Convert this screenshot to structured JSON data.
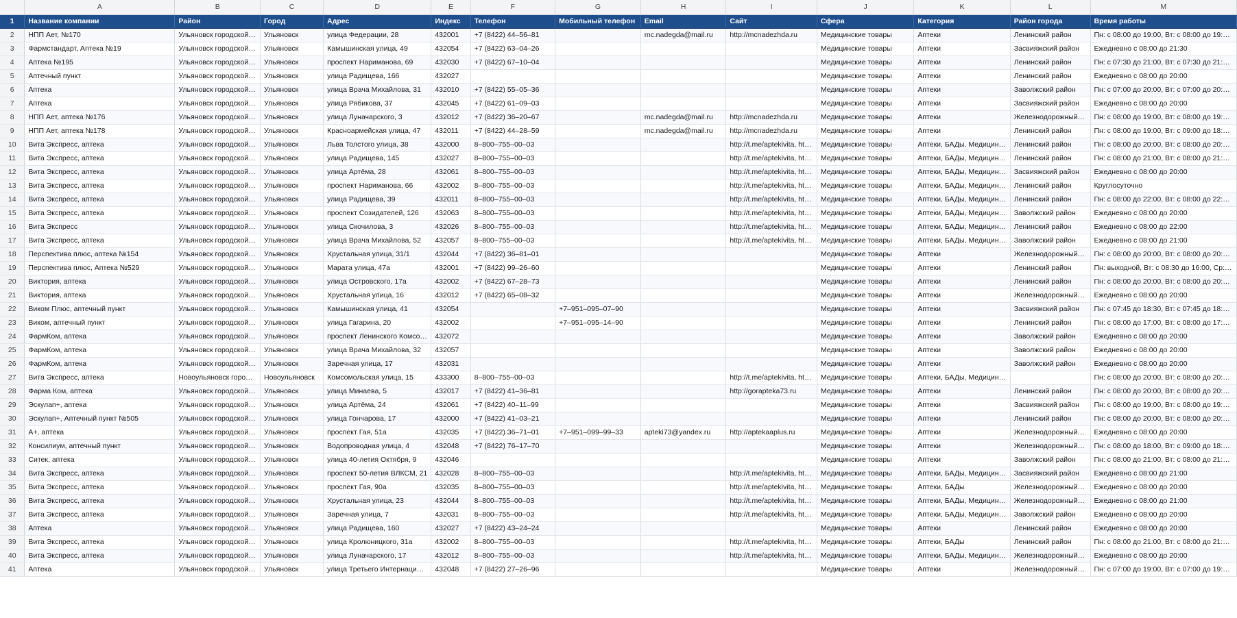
{
  "columns": [
    "A",
    "B",
    "C",
    "D",
    "E",
    "F",
    "G",
    "H",
    "I",
    "J",
    "K",
    "L",
    "M"
  ],
  "header": {
    "row": "1",
    "cells": [
      "Название компании",
      "Район",
      "Город",
      "Адрес",
      "Индекс",
      "Телефон",
      "Мобильный телефон",
      "Email",
      "Сайт",
      "Сфера",
      "Категория",
      "Район города",
      "Время работы"
    ]
  },
  "rows": [
    {
      "n": "2",
      "c": [
        "НПП Ает, №170",
        "Ульяновск городской …",
        "Ульяновск",
        "улица Федерации, 28",
        "432001",
        "+7 (8422) 44–56–81",
        "",
        "mc.nadegda@mail.ru",
        "http://mcnadezhda.ru",
        "Медицинские товары",
        "Аптеки",
        "Ленинский район",
        "Пн: с 08:00 до 19:00, Вт: с 08:00 до 19:00, С…"
      ]
    },
    {
      "n": "3",
      "c": [
        "Фармстандарт, Аптека №19",
        "Ульяновск городской …",
        "Ульяновск",
        "Камышинская улица, 49",
        "432054",
        "+7 (8422) 63–04–26",
        "",
        "",
        "",
        "Медицинские товары",
        "Аптеки",
        "Засвияжский район",
        "Ежедневно с 08:00 до 21:30"
      ]
    },
    {
      "n": "4",
      "c": [
        "Аптека №195",
        "Ульяновск городской …",
        "Ульяновск",
        "проспект Нариманова, 69",
        "432030",
        "+7 (8422) 67–10–04",
        "",
        "",
        "",
        "Медицинские товары",
        "Аптеки",
        "Ленинский район",
        "Пн: с 07:30 до 21:00, Вт: с 07:30 до 21:00, С…"
      ]
    },
    {
      "n": "5",
      "c": [
        "Аптечный пункт",
        "Ульяновск городской …",
        "Ульяновск",
        "улица Радищева, 166",
        "432027",
        "",
        "",
        "",
        "",
        "Медицинские товары",
        "Аптеки",
        "Ленинский район",
        "Ежедневно с 08:00 до 20:00"
      ]
    },
    {
      "n": "6",
      "c": [
        "Аптека",
        "Ульяновск городской …",
        "Ульяновск",
        "улица Врача Михайлова, 31",
        "432010",
        "+7 (8422) 55–05–36",
        "",
        "",
        "",
        "Медицинские товары",
        "Аптеки",
        "Заволжский район",
        "Пн: с 07:00 до 20:00, Вт: с 07:00 до 20:00, С…"
      ]
    },
    {
      "n": "7",
      "c": [
        "Аптека",
        "Ульяновск городской …",
        "Ульяновск",
        "улица Рябикова, 37",
        "432045",
        "+7 (8422) 61–09–03",
        "",
        "",
        "",
        "Медицинские товары",
        "Аптеки",
        "Засвияжский район",
        "Ежедневно с 08:00 до 20:00"
      ]
    },
    {
      "n": "8",
      "c": [
        "НПП Ает, аптека №176",
        "Ульяновск городской …",
        "Ульяновск",
        "улица Луначарского, 3",
        "432012",
        "+7 (8422) 36–20–67",
        "",
        "mc.nadegda@mail.ru",
        "http://mcnadezhda.ru",
        "Медицинские товары",
        "Аптеки",
        "Железнодорожный р…",
        "Пн: с 08:00 до 19:00, Вт: с 08:00 до 19:00, С…"
      ]
    },
    {
      "n": "9",
      "c": [
        "НПП Ает, аптека №178",
        "Ульяновск городской …",
        "Ульяновск",
        "Красноармейская улица, 47",
        "432011",
        "+7 (8422) 44–28–59",
        "",
        "mc.nadegda@mail.ru",
        "http://mcnadezhda.ru",
        "Медицинские товары",
        "Аптеки",
        "Ленинский район",
        "Пн: с 08:00 до 19:00, Вт: с 09:00 до 18:00, С…"
      ]
    },
    {
      "n": "10",
      "c": [
        "Вита Экспресс, аптека",
        "Ульяновск городской …",
        "Ульяновск",
        "Льва Толстого улица, 38",
        "432000",
        "8–800–755–00–03",
        "",
        "",
        "http://t.me/aptekivita, htt…",
        "Медицинские товары",
        "Аптеки, БАДы, Медицинск…",
        "Ленинский район",
        "Пн: с 08:00 до 20:00, Вт: с 08:00 до 20:00, С…"
      ]
    },
    {
      "n": "11",
      "c": [
        "Вита Экспресс, аптека",
        "Ульяновск городской …",
        "Ульяновск",
        "улица Радищева, 145",
        "432027",
        "8–800–755–00–03",
        "",
        "",
        "http://t.me/aptekivita, htt…",
        "Медицинские товары",
        "Аптеки, БАДы, Медицинск…",
        "Ленинский район",
        "Пн: с 08:00 до 21:00, Вт: с 08:00 до 21:00, С…"
      ]
    },
    {
      "n": "12",
      "c": [
        "Вита Экспресс, аптека",
        "Ульяновск городской …",
        "Ульяновск",
        "улица Артёма, 28",
        "432061",
        "8–800–755–00–03",
        "",
        "",
        "http://t.me/aptekivita, htt…",
        "Медицинские товары",
        "Аптеки, БАДы, Медицинск…",
        "Засвияжский район",
        "Ежедневно с 08:00 до 20:00"
      ]
    },
    {
      "n": "13",
      "c": [
        "Вита Экспресс, аптека",
        "Ульяновск городской …",
        "Ульяновск",
        "проспект Нариманова, 66",
        "432002",
        "8–800–755–00–03",
        "",
        "",
        "http://t.me/aptekivita, htt…",
        "Медицинские товары",
        "Аптеки, БАДы, Медицинск…",
        "Ленинский район",
        "Круглосуточно"
      ]
    },
    {
      "n": "14",
      "c": [
        "Вита Экспресс, аптека",
        "Ульяновск городской …",
        "Ульяновск",
        "улица Радищева, 39",
        "432011",
        "8–800–755–00–03",
        "",
        "",
        "http://t.me/aptekivita, htt…",
        "Медицинские товары",
        "Аптеки, БАДы, Медицинск…",
        "Ленинский район",
        "Пн: с 08:00 до 22:00, Вт: с 08:00 до 22:00, С…"
      ]
    },
    {
      "n": "15",
      "c": [
        "Вита Экспресс, аптека",
        "Ульяновск городской …",
        "Ульяновск",
        "проспект Созидателей, 126",
        "432063",
        "8–800–755–00–03",
        "",
        "",
        "http://t.me/aptekivita, htt…",
        "Медицинские товары",
        "Аптеки, БАДы, Медицинск…",
        "Заволжский район",
        "Ежедневно с 08:00 до 20:00"
      ]
    },
    {
      "n": "16",
      "c": [
        "Вита Экспресс",
        "Ульяновск городской …",
        "Ульяновск",
        "улица Скочилова, 3",
        "432026",
        "8–800–755–00–03",
        "",
        "",
        "http://t.me/aptekivita, htt…",
        "Медицинские товары",
        "Аптеки, БАДы, Медицинск…",
        "Ленинский район",
        "Ежедневно с 08:00 до 22:00"
      ]
    },
    {
      "n": "17",
      "c": [
        "Вита Экспресс, аптека",
        "Ульяновск городской …",
        "Ульяновск",
        "улица Врача Михайлова, 52",
        "432057",
        "8–800–755–00–03",
        "",
        "",
        "http://t.me/aptekivita, htt…",
        "Медицинские товары",
        "Аптеки, БАДы, Медицинск…",
        "Заволжский район",
        "Ежедневно с 08:00 до 21:00"
      ]
    },
    {
      "n": "18",
      "c": [
        "Перспектива плюс, аптека №154",
        "Ульяновск городской …",
        "Ульяновск",
        "Хрустальная улица, 31/1",
        "432044",
        "+7 (8422) 36–81–01",
        "",
        "",
        "",
        "Медицинские товары",
        "Аптеки",
        "Железнодорожный р…",
        "Пн: с 08:00 до 20:00, Вт: с 08:00 до 20:00, С…"
      ]
    },
    {
      "n": "19",
      "c": [
        "Перспектива плюс, Аптека №529",
        "Ульяновск городской …",
        "Ульяновск",
        "Марата улица, 47а",
        "432001",
        "+7 (8422) 99–26–60",
        "",
        "",
        "",
        "Медицинские товары",
        "Аптеки",
        "Ленинский район",
        "Пн: выходной, Вт: с 08:30 до 16:00, Ср: с 0…"
      ]
    },
    {
      "n": "20",
      "c": [
        "Виктория, аптека",
        "Ульяновск городской …",
        "Ульяновск",
        "улица Островского, 17а",
        "432002",
        "+7 (8422) 67–28–73",
        "",
        "",
        "",
        "Медицинские товары",
        "Аптеки",
        "Ленинский район",
        "Пн: с 08:00 до 20:00, Вт: с 08:00 до 20:00, С…"
      ]
    },
    {
      "n": "21",
      "c": [
        "Виктория, аптека",
        "Ульяновск городской …",
        "Ульяновск",
        "Хрустальная улица, 16",
        "432012",
        "+7 (8422) 65–08–32",
        "",
        "",
        "",
        "Медицинские товары",
        "Аптеки",
        "Железнодорожный р…",
        "Ежедневно с 08:00 до 20:00"
      ]
    },
    {
      "n": "22",
      "c": [
        "Виком Плюс, аптечный пункт",
        "Ульяновск городской …",
        "Ульяновск",
        "Камышинская улица, 41",
        "432054",
        "",
        "+7–951–095–07–90",
        "",
        "",
        "Медицинские товары",
        "Аптеки",
        "Засвияжский район",
        "Пн: с 07:45 до 18:30, Вт: с 07:45 до 18:30, С…"
      ]
    },
    {
      "n": "23",
      "c": [
        "Виком, аптечный пункт",
        "Ульяновск городской …",
        "Ульяновск",
        "улица Гагарина, 20",
        "432002",
        "",
        "+7–951–095–14–90",
        "",
        "",
        "Медицинские товары",
        "Аптеки",
        "Ленинский район",
        "Пн: с 08:00 до 17:00, Вт: с 08:00 до 17:00, С…"
      ]
    },
    {
      "n": "24",
      "c": [
        "ФармКом, аптека",
        "Ульяновск городской …",
        "Ульяновск",
        "проспект Ленинского Комсом…",
        "432072",
        "",
        "",
        "",
        "",
        "Медицинские товары",
        "Аптеки",
        "Заволжский район",
        "Ежедневно с 08:00 до 20:00"
      ]
    },
    {
      "n": "25",
      "c": [
        "ФармКом, аптека",
        "Ульяновск городской …",
        "Ульяновск",
        "улица Врача Михайлова, 32",
        "432057",
        "",
        "",
        "",
        "",
        "Медицинские товары",
        "Аптеки",
        "Заволжский район",
        "Ежедневно с 08:00 до 20:00"
      ]
    },
    {
      "n": "26",
      "c": [
        "ФармКом, аптека",
        "Ульяновск городской …",
        "Ульяновск",
        "Заречная улица, 17",
        "432031",
        "",
        "",
        "",
        "",
        "Медицинские товары",
        "Аптеки",
        "Заволжский район",
        "Ежедневно с 08:00 до 20:00"
      ]
    },
    {
      "n": "27",
      "c": [
        "Вита Экспресс, аптека",
        "Новоульяновск городс…",
        "Новоульяновск",
        "Комсомольская улица, 15",
        "433300",
        "8–800–755–00–03",
        "",
        "",
        "http://t.me/aptekivita, htt…",
        "Медицинские товары",
        "Аптеки, БАДы, Медицинск…",
        "",
        "Пн: с 08:00 до 20:00, Вт: с 08:00 до 20:00, С…"
      ]
    },
    {
      "n": "28",
      "c": [
        "Фарма Ком, аптека",
        "Ульяновск городской …",
        "Ульяновск",
        "улица Минаева, 5",
        "432017",
        "+7 (8422) 41–36–81",
        "",
        "",
        "http://gorapteka73.ru",
        "Медицинские товары",
        "Аптеки",
        "Ленинский район",
        "Пн: с 08:00 до 20:00, Вт: с 08:00 до 20:00, С…"
      ]
    },
    {
      "n": "29",
      "c": [
        "Эскулап+, аптека",
        "Ульяновск городской …",
        "Ульяновск",
        "улица Артёма, 24",
        "432061",
        "+7 (8422) 40–11–99",
        "",
        "",
        "",
        "Медицинские товары",
        "Аптеки",
        "Засвияжский район",
        "Пн: с 08:00 до 19:00, Вт: с 08:00 до 19:00, С…"
      ]
    },
    {
      "n": "30",
      "c": [
        "Эскулап+, Аптечный пункт №505",
        "Ульяновск городской …",
        "Ульяновск",
        "улица Гончарова, 17",
        "432000",
        "+7 (8422) 41–03–21",
        "",
        "",
        "",
        "Медицинские товары",
        "Аптеки",
        "Ленинский район",
        "Пн: с 08:00 до 20:00, Вт: с 08:00 до 20:00, С…"
      ]
    },
    {
      "n": "31",
      "c": [
        "А+, аптека",
        "Ульяновск городской …",
        "Ульяновск",
        "проспект Гая, 51а",
        "432035",
        "+7 (8422) 36–71–01",
        "+7–951–099–99–33",
        "apteki73@yandex.ru",
        "http://aptekaaplus.ru",
        "Медицинские товары",
        "Аптеки",
        "Железнодорожный р…",
        "Ежедневно с 08:00 до 20:00"
      ]
    },
    {
      "n": "32",
      "c": [
        "Консилиум, аптечный пункт",
        "Ульяновск городской …",
        "Ульяновск",
        "Водопроводная улица, 4",
        "432048",
        "+7 (8422) 76–17–70",
        "",
        "",
        "",
        "Медицинские товары",
        "Аптеки",
        "Железнодорожный р…",
        "Пн: с 08:00 до 18:00, Вт: с 09:00 до 18:00, С…"
      ]
    },
    {
      "n": "33",
      "c": [
        "Ситек, аптека",
        "Ульяновск городской …",
        "Ульяновск",
        "улица 40-летия Октября, 9",
        "432046",
        "",
        "",
        "",
        "",
        "Медицинские товары",
        "Аптеки",
        "Заволжский район",
        "Пн: с 08:00 до 21:00, Вт: с 08:00 до 21:00, С…"
      ]
    },
    {
      "n": "34",
      "c": [
        "Вита Экспресс, аптека",
        "Ульяновск городской …",
        "Ульяновск",
        "проспект 50-летия ВЛКСМ, 21",
        "432028",
        "8–800–755–00–03",
        "",
        "",
        "http://t.me/aptekivita, htt…",
        "Медицинские товары",
        "Аптеки, БАДы, Медицинск…",
        "Засвияжский район",
        "Ежедневно с 08:00 до 21:00"
      ]
    },
    {
      "n": "35",
      "c": [
        "Вита Экспресс, аптека",
        "Ульяновск городской …",
        "Ульяновск",
        "проспект Гая, 90а",
        "432035",
        "8–800–755–00–03",
        "",
        "",
        "http://t.me/aptekivita, htt…",
        "Медицинские товары",
        "Аптеки, БАДы",
        "Железнодорожный р…",
        "Ежедневно с 08:00 до 20:00"
      ]
    },
    {
      "n": "36",
      "c": [
        "Вита Экспресс, аптека",
        "Ульяновск городской …",
        "Ульяновск",
        "Хрустальная улица, 23",
        "432044",
        "8–800–755–00–03",
        "",
        "",
        "http://t.me/aptekivita, htt…",
        "Медицинские товары",
        "Аптеки, БАДы, Медицинск…",
        "Железнодорожный р…",
        "Ежедневно с 08:00 до 21:00"
      ]
    },
    {
      "n": "37",
      "c": [
        "Вита Экспресс, аптека",
        "Ульяновск городской …",
        "Ульяновск",
        "Заречная улица, 7",
        "432031",
        "8–800–755–00–03",
        "",
        "",
        "http://t.me/aptekivita, htt…",
        "Медицинские товары",
        "Аптеки, БАДы, Медицинск…",
        "Заволжский район",
        "Ежедневно с 08:00 до 20:00"
      ]
    },
    {
      "n": "38",
      "c": [
        "Аптека",
        "Ульяновск городской …",
        "Ульяновск",
        "улица Радищева, 160",
        "432027",
        "+7 (8422) 43–24–24",
        "",
        "",
        "",
        "Медицинские товары",
        "Аптеки",
        "Ленинский район",
        "Ежедневно с 08:00 до 20:00"
      ]
    },
    {
      "n": "39",
      "c": [
        "Вита Экспресс, аптека",
        "Ульяновск городской …",
        "Ульяновск",
        "улица Кролюницкого, 31а",
        "432002",
        "8–800–755–00–03",
        "",
        "",
        "http://t.me/aptekivita, htt…",
        "Медицинские товары",
        "Аптеки, БАДы",
        "Ленинский район",
        "Пн: с 08:00 до 21:00, Вт: с 08:00 до 21:00, С…"
      ]
    },
    {
      "n": "40",
      "c": [
        "Вита Экспресс, аптека",
        "Ульяновск городской …",
        "Ульяновск",
        "улица Луначарского, 17",
        "432012",
        "8–800–755–00–03",
        "",
        "",
        "http://t.me/aptekivita, htt…",
        "Медицинские товары",
        "Аптеки, БАДы, Медицинск…",
        "Железнодорожный р…",
        "Ежедневно с 08:00 до 20:00"
      ]
    },
    {
      "n": "41",
      "c": [
        "Аптека",
        "Ульяновск городской …",
        "Ульяновск",
        "улица Третьего Интернацион…",
        "432048",
        "+7 (8422) 27–26–96",
        "",
        "",
        "",
        "Медицинские товары",
        "Аптеки",
        "Железнодорожный р…",
        "Пн: с 07:00 до 19:00, Вт: с 07:00 до 19:00, С…"
      ]
    }
  ]
}
